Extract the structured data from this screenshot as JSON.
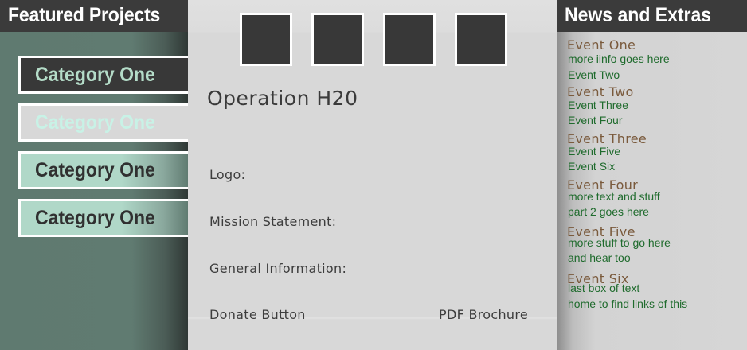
{
  "left_panel": {
    "heading": "Featured Projects",
    "categories": [
      {
        "label": "Category One"
      },
      {
        "label": "Category One"
      },
      {
        "label": "Category One"
      },
      {
        "label": "Category One"
      }
    ]
  },
  "center_panel": {
    "title": "Operation H20",
    "fields": {
      "logo": "Logo:",
      "mission": "Mission Statement:",
      "general": "General Information:",
      "donate": "Donate Button",
      "pdf": "PDF Brochure"
    }
  },
  "right_panel": {
    "heading": "News and Extras",
    "events": [
      {
        "title": "Event One",
        "lines": [
          "more iinfo goes here",
          "Event Two"
        ]
      },
      {
        "title": "Event Two",
        "lines": [
          "Event Three",
          "Event Four"
        ]
      },
      {
        "title": "Event Three",
        "lines": [
          "Event Five",
          "Event Six"
        ]
      },
      {
        "title": "Event Four",
        "lines": [
          "more text and stuff",
          "part 2 goes here"
        ]
      },
      {
        "title": "Event Five",
        "lines": [
          "more stuff to go here",
          "and hear too"
        ]
      },
      {
        "title": "Event Six",
        "lines": [
          "last box of text",
          "home to find links of this"
        ]
      }
    ]
  },
  "colors": {
    "header_bg": "#3b3b3b",
    "sidebar_green": "#5f7a70",
    "category_mint": "#b0d8c8",
    "event_title": "#7a5a3c",
    "event_text": "#1f6b2d"
  }
}
